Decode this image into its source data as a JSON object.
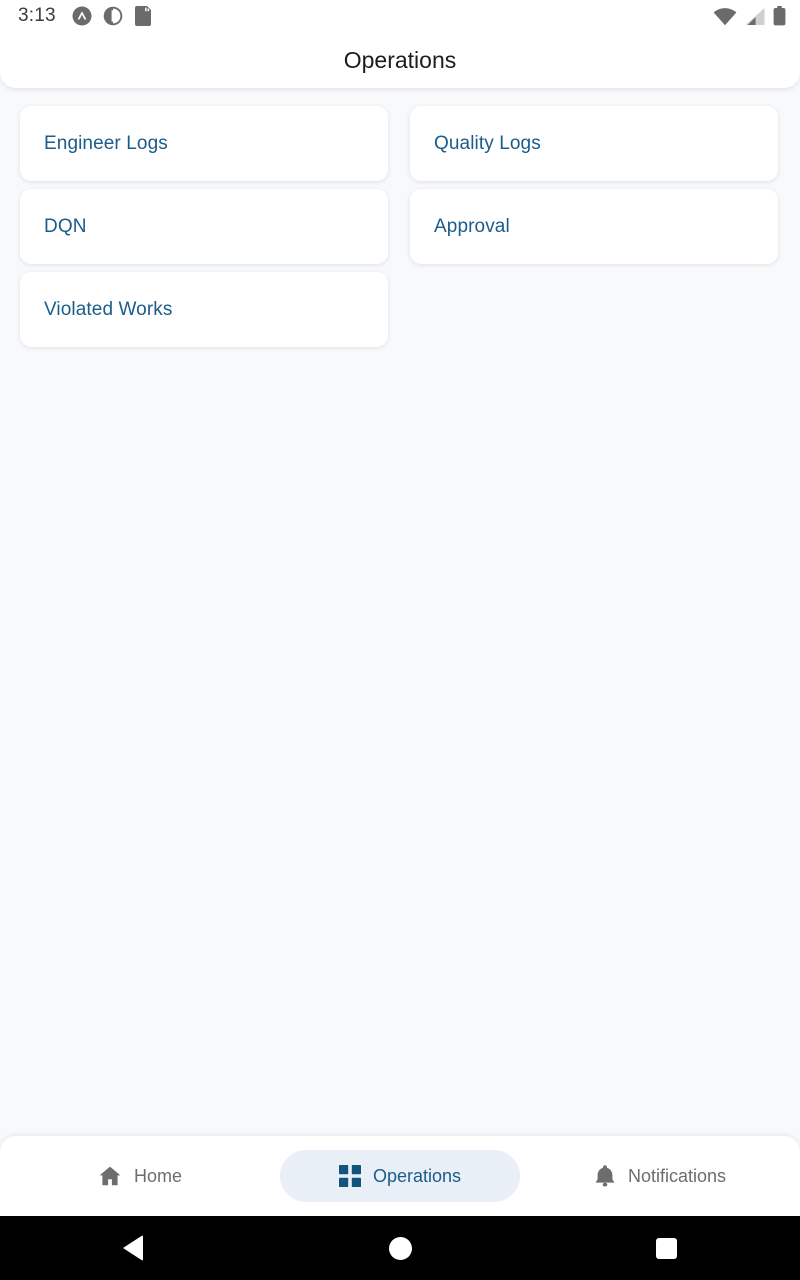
{
  "status_bar": {
    "time": "3:13",
    "left_icons": [
      "app-badge-icon",
      "theme-contrast-icon",
      "sd-card-icon"
    ],
    "right_icons": [
      "wifi-icon",
      "cellular-signal-icon",
      "battery-icon"
    ]
  },
  "header": {
    "title": "Operations"
  },
  "colors": {
    "accent_blue": "#1b5c8a",
    "page_background": "#f7f9fb",
    "card_background": "#ffffff",
    "active_pill": "#e8eff6",
    "inactive_nav_text": "#6d6d6d"
  },
  "main": {
    "cards": [
      {
        "label": "Engineer Logs",
        "name": "engineer-logs"
      },
      {
        "label": "Quality Logs",
        "name": "quality-logs"
      },
      {
        "label": "DQN",
        "name": "dqn"
      },
      {
        "label": "Approval",
        "name": "approval"
      },
      {
        "label": "Violated Works",
        "name": "violated-works"
      }
    ]
  },
  "bottom_nav": {
    "items": [
      {
        "label": "Home",
        "icon": "home-icon",
        "active": false
      },
      {
        "label": "Operations",
        "icon": "grid-icon",
        "active": true
      },
      {
        "label": "Notifications",
        "icon": "bell-icon",
        "active": false
      }
    ]
  },
  "system_nav": {
    "back": "back-button",
    "home": "home-button",
    "recents": "recents-button"
  }
}
